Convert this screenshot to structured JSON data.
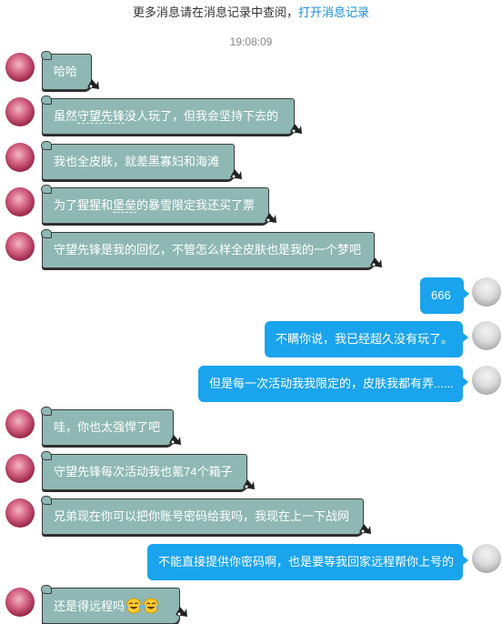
{
  "notice": {
    "text": "更多消息请在消息记录中查阅，",
    "link": "打开消息记录"
  },
  "timestamp": "19:08:09",
  "colors": {
    "their_bubble": "#8fb8b4",
    "my_bubble": "#1aa4ee",
    "link": "#1a8fe0"
  },
  "messages": [
    {
      "side": "theirs",
      "parts": [
        "哈哈"
      ]
    },
    {
      "side": "theirs",
      "parts": [
        "虽然",
        "守望先锋",
        "没人玩了，但我会坚持下去的"
      ]
    },
    {
      "side": "theirs",
      "parts": [
        "我也全皮肤，就差黑寡妇和海滩"
      ]
    },
    {
      "side": "theirs",
      "parts": [
        "为了猩猩和",
        "堡垒",
        "的暴雪限定我还买了票"
      ]
    },
    {
      "side": "theirs",
      "parts": [
        "守望先锋是我的回忆，不管怎么样全皮肤也是我的一个梦吧"
      ]
    },
    {
      "side": "mine",
      "parts": [
        "666"
      ]
    },
    {
      "side": "mine",
      "parts": [
        "不瞒你说，我已经超久没有玩了。"
      ]
    },
    {
      "side": "mine",
      "parts": [
        "但是每一次活动我我限定的，皮肤我都有弄......"
      ]
    },
    {
      "side": "theirs",
      "parts": [
        "哇，你也太强悍了吧"
      ]
    },
    {
      "side": "theirs",
      "parts": [
        "守望先锋每次活动我也氪74个箱子"
      ]
    },
    {
      "side": "theirs",
      "parts": [
        "兄弟现在你可以把你账号密码给我吗，我现在上一下战网"
      ]
    },
    {
      "side": "mine",
      "parts": [
        "不能直接提供你密码啊，也是要等我回家远程帮你上号的"
      ]
    },
    {
      "side": "theirs",
      "parts": [
        "还是得远程吗"
      ],
      "emoji": [
        "laugh-cry-emoji",
        "laugh-cry-emoji"
      ]
    }
  ]
}
